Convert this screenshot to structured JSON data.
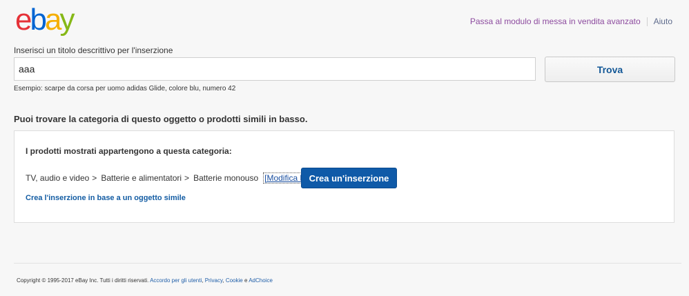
{
  "logo": {
    "letters": [
      "e",
      "b",
      "a",
      "y"
    ],
    "colors": [
      "#e53238",
      "#0064d2",
      "#f5af02",
      "#86b817"
    ]
  },
  "header": {
    "advanced_link": "Passa al modulo di messa in vendita avanzato",
    "help_link": "Aiuto"
  },
  "form": {
    "title_label": "Inserisci un titolo descrittivo per l'inserzione",
    "title_value": "aaa",
    "search_button": "Trova",
    "example_text": "Esempio: scarpe da corsa per uomo adidas Glide, colore blu, numero 42"
  },
  "section": {
    "heading": "Puoi trovare la categoria di questo oggetto o prodotti simili in basso."
  },
  "panel": {
    "heading": "I prodotti mostrati appartengono a questa categoria:",
    "breadcrumbs": [
      "TV, audio e video",
      "Batterie e alimentatori",
      "Batterie monouso"
    ],
    "separator": ">",
    "modify_link": "[Modifica la]",
    "create_button": "Crea un'inserzione",
    "similar_link": "Crea l'inserzione in base a un oggetto simile"
  },
  "footer": {
    "copyright": "Copyright © 1995-2017 eBay Inc. Tutti i diritti riservati.",
    "links": [
      "Accordo per gli utenti",
      "Privacy",
      "Cookie",
      "AdChoice"
    ],
    "comma": ",",
    "and": "e"
  }
}
